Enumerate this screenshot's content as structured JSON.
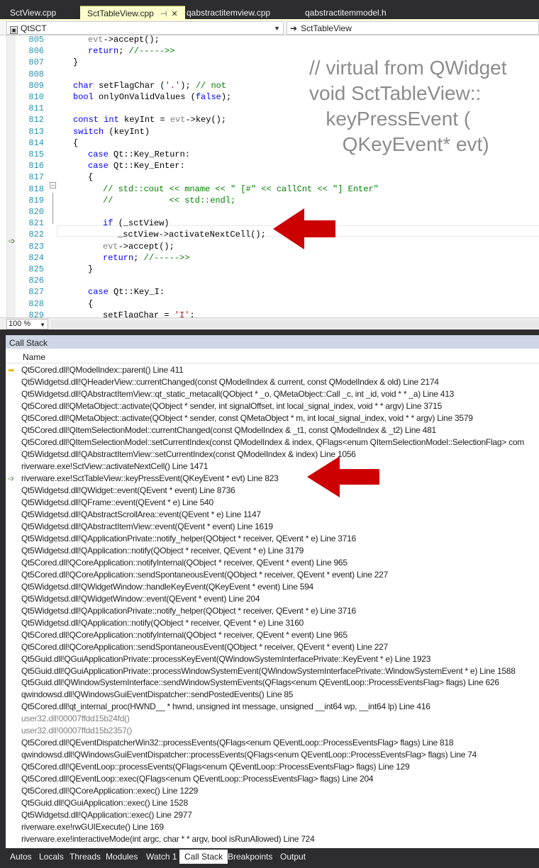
{
  "tabs": [
    {
      "label": "SctView.cpp",
      "active": false
    },
    {
      "label": "SctTableView.cpp",
      "active": true,
      "pin": "⊣",
      "close": "✕"
    },
    {
      "label": "qabstractitemview.cpp",
      "active": false
    },
    {
      "label": "qabstractitemmodel.h",
      "active": false
    }
  ],
  "navbar": {
    "scope": "QtSCT",
    "member": "SctTableView"
  },
  "editor": {
    "annotation": "// virtual from QWidget\nvoid SctTableView::\n   keyPressEvent (\n      QKeyEvent* evt)",
    "lines": [
      {
        "n": "805",
        "code": "evt->accept();"
      },
      {
        "n": "806",
        "code": "return; //----->>"
      },
      {
        "n": "807",
        "code": "}"
      },
      {
        "n": "808",
        "code": ""
      },
      {
        "n": "809",
        "code": "char setFlagChar ('.'); // not"
      },
      {
        "n": "810",
        "code": "bool onlyOnValidValues (false);"
      },
      {
        "n": "811",
        "code": ""
      },
      {
        "n": "812",
        "code": "const int keyInt = evt->key();"
      },
      {
        "n": "813",
        "code": "switch (keyInt)"
      },
      {
        "n": "814",
        "code": "{"
      },
      {
        "n": "815",
        "code": "case Qt::Key_Return:"
      },
      {
        "n": "816",
        "code": "case Qt::Key_Enter:"
      },
      {
        "n": "817",
        "code": "{"
      },
      {
        "n": "818",
        "code": "// std::cout << mname << \" [#\" << callCnt << \"] Enter\""
      },
      {
        "n": "819",
        "code": "//           << std::endl;"
      },
      {
        "n": "820",
        "code": ""
      },
      {
        "n": "821",
        "code": "if (_sctView)"
      },
      {
        "n": "822",
        "code": "_sctView->activateNextCell();"
      },
      {
        "n": "823",
        "code": "evt->accept();"
      },
      {
        "n": "824",
        "code": "return; //----->>"
      },
      {
        "n": "825",
        "code": "}"
      },
      {
        "n": "826",
        "code": ""
      },
      {
        "n": "827",
        "code": "case Qt::Key_I:"
      },
      {
        "n": "828",
        "code": "{"
      },
      {
        "n": "829",
        "code": "setFlagChar = 'I';"
      }
    ],
    "zoom": "100 %"
  },
  "callstack": {
    "title": "Call Stack",
    "column": "Name",
    "frames": [
      {
        "text": "Qt5Cored.dll!QModelIndex::parent() Line 411",
        "icon": "current"
      },
      {
        "text": "Qt5Widgetsd.dll!QHeaderView::currentChanged(const QModelIndex & current, const QModelIndex & old) Line 2174"
      },
      {
        "text": "Qt5Widgetsd.dll!QAbstractItemView::qt_static_metacall(QObject * _o, QMetaObject::Call _c, int _id, void * * _a) Line 413"
      },
      {
        "text": "Qt5Cored.dll!QMetaObject::activate(QObject * sender, int signalOffset, int local_signal_index, void * * argv) Line 3715"
      },
      {
        "text": "Qt5Cored.dll!QMetaObject::activate(QObject * sender, const QMetaObject * m, int local_signal_index, void * * argv) Line 3579"
      },
      {
        "text": "Qt5Cored.dll!QItemSelectionModel::currentChanged(const QModelIndex & _t1, const QModelIndex & _t2) Line 481"
      },
      {
        "text": "Qt5Cored.dll!QItemSelectionModel::setCurrentIndex(const QModelIndex & index, QFlags<enum QItemSelectionModel::SelectionFlag> com"
      },
      {
        "text": "Qt5Widgetsd.dll!QAbstractItemView::setCurrentIndex(const QModelIndex & index) Line 1056"
      },
      {
        "text": "riverware.exe!SctView::activateNextCell() Line 1471"
      },
      {
        "text": "riverware.exe!SctTableView::keyPressEvent(QKeyEvent * evt) Line 823",
        "icon": "return"
      },
      {
        "text": "Qt5Widgetsd.dll!QWidget::event(QEvent * event) Line 8736"
      },
      {
        "text": "Qt5Widgetsd.dll!QFrame::event(QEvent * e) Line 540"
      },
      {
        "text": "Qt5Widgetsd.dll!QAbstractScrollArea::event(QEvent * e) Line 1147"
      },
      {
        "text": "Qt5Widgetsd.dll!QAbstractItemView::event(QEvent * event) Line 1619"
      },
      {
        "text": "Qt5Widgetsd.dll!QApplicationPrivate::notify_helper(QObject * receiver, QEvent * e) Line 3716"
      },
      {
        "text": "Qt5Widgetsd.dll!QApplication::notify(QObject * receiver, QEvent * e) Line 3179"
      },
      {
        "text": "Qt5Cored.dll!QCoreApplication::notifyInternal(QObject * receiver, QEvent * event) Line 965"
      },
      {
        "text": "Qt5Cored.dll!QCoreApplication::sendSpontaneousEvent(QObject * receiver, QEvent * event) Line 227"
      },
      {
        "text": "Qt5Widgetsd.dll!QWidgetWindow::handleKeyEvent(QKeyEvent * event) Line 594"
      },
      {
        "text": "Qt5Widgetsd.dll!QWidgetWindow::event(QEvent * event) Line 204"
      },
      {
        "text": "Qt5Widgetsd.dll!QApplicationPrivate::notify_helper(QObject * receiver, QEvent * e) Line 3716"
      },
      {
        "text": "Qt5Widgetsd.dll!QApplication::notify(QObject * receiver, QEvent * e) Line 3160"
      },
      {
        "text": "Qt5Cored.dll!QCoreApplication::notifyInternal(QObject * receiver, QEvent * event) Line 965"
      },
      {
        "text": "Qt5Cored.dll!QCoreApplication::sendSpontaneousEvent(QObject * receiver, QEvent * event) Line 227"
      },
      {
        "text": "Qt5Guid.dll!QGuiApplicationPrivate::processKeyEvent(QWindowSystemInterfacePrivate::KeyEvent * e) Line 1923"
      },
      {
        "text": "Qt5Guid.dll!QGuiApplicationPrivate::processWindowSystemEvent(QWindowSystemInterfacePrivate::WindowSystemEvent * e) Line 1588"
      },
      {
        "text": "Qt5Guid.dll!QWindowSystemInterface::sendWindowSystemEvents(QFlags<enum QEventLoop::ProcessEventsFlag> flags) Line 626"
      },
      {
        "text": "qwindowsd.dll!QWindowsGuiEventDispatcher::sendPostedEvents() Line 85"
      },
      {
        "text": "Qt5Cored.dll!qt_internal_proc(HWND__ * hwnd, unsigned int message, unsigned __int64 wp, __int64 lp) Line 416"
      },
      {
        "text": "user32.dll!00007ffdd15b24fd()",
        "external": true
      },
      {
        "text": "user32.dll!00007ffdd15b2357()",
        "external": true
      },
      {
        "text": "Qt5Cored.dll!QEventDispatcherWin32::processEvents(QFlags<enum QEventLoop::ProcessEventsFlag> flags) Line 818"
      },
      {
        "text": "qwindowsd.dll!QWindowsGuiEventDispatcher::processEvents(QFlags<enum QEventLoop::ProcessEventsFlag> flags) Line 74"
      },
      {
        "text": "Qt5Cored.dll!QEventLoop::processEvents(QFlags<enum QEventLoop::ProcessEventsFlag> flags) Line 129"
      },
      {
        "text": "Qt5Cored.dll!QEventLoop::exec(QFlags<enum QEventLoop::ProcessEventsFlag> flags) Line 204"
      },
      {
        "text": "Qt5Cored.dll!QCoreApplication::exec() Line 1229"
      },
      {
        "text": "Qt5Guid.dll!QGuiApplication::exec() Line 1528"
      },
      {
        "text": "Qt5Widgetsd.dll!QApplication::exec() Line 2977"
      },
      {
        "text": "riverware.exe!rwGUIExecute() Line 169"
      },
      {
        "text": "riverware.exe!interactiveMode(int argc, char * * argv, bool isRunAllowed) Line 724"
      }
    ]
  },
  "bottom_tabs": [
    {
      "label": "Autos"
    },
    {
      "label": "Locals"
    },
    {
      "label": "Threads"
    },
    {
      "label": "Modules"
    },
    {
      "label": "Watch 1"
    },
    {
      "label": "Call Stack",
      "active": true
    },
    {
      "label": "Breakpoints"
    },
    {
      "label": "Output"
    }
  ],
  "colors": {
    "annotation_arrow": "#cc0000",
    "keyword": "#0000ff",
    "comment": "#008000",
    "string": "#a31515",
    "line_number": "#2b91af"
  }
}
